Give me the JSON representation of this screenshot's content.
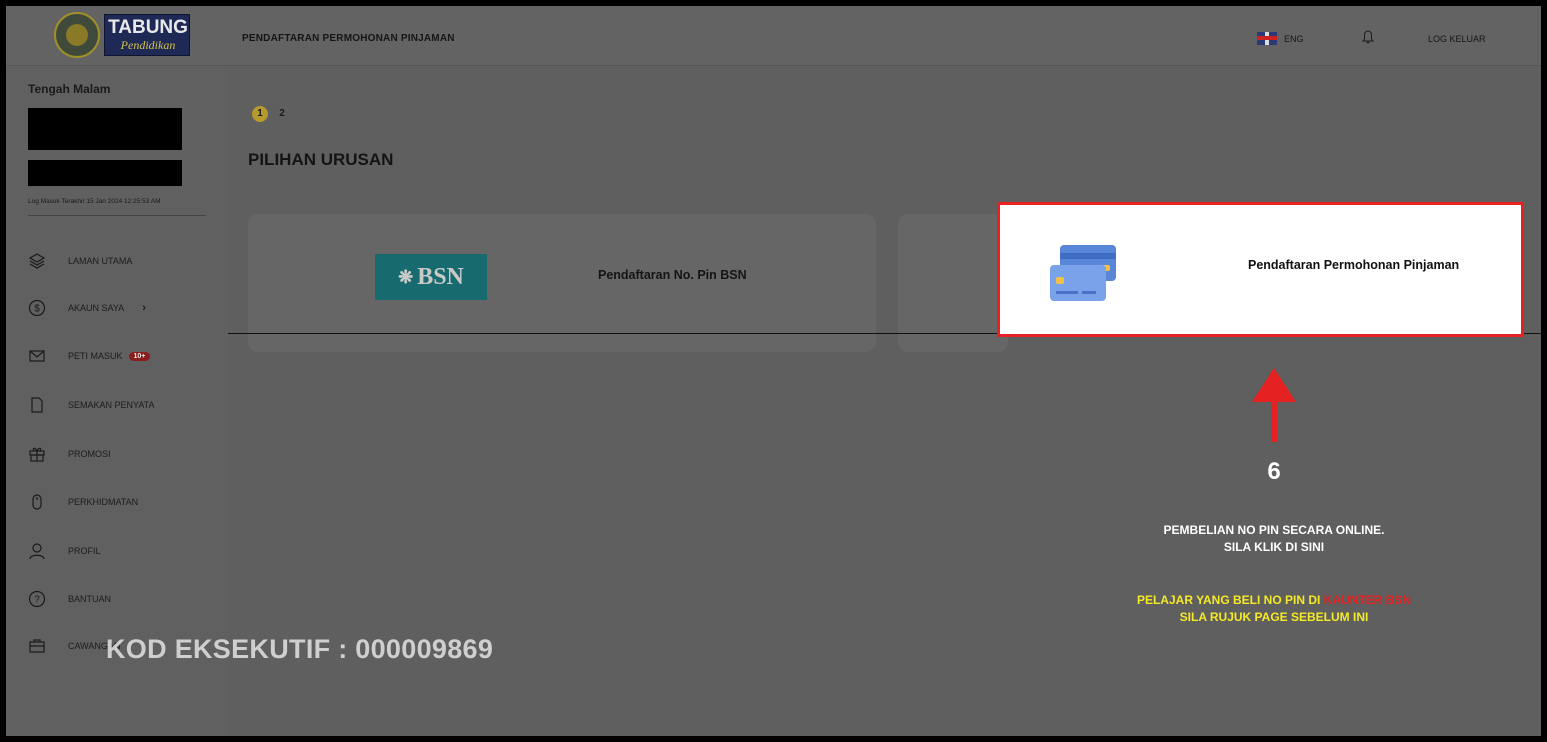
{
  "header": {
    "logo_title": "TABUNG",
    "logo_subtitle": "Pendidikan",
    "page_heading": "PENDAFTARAN PERMOHONAN PINJAMAN",
    "language": "ENG",
    "logout_label": "LOG KELUAR"
  },
  "sidebar": {
    "greeting": "Tengah Malam",
    "last_login": "Log Masuk Terakhir 15 Jan 2024 12:25:53 AM",
    "items": [
      {
        "label": "LAMAN UTAMA",
        "icon": "layers-icon"
      },
      {
        "label": "AKAUN SAYA",
        "icon": "dollar-circle-icon",
        "chevron": "›"
      },
      {
        "label": "PETI MASUK",
        "icon": "mail-icon",
        "badge": "10+"
      },
      {
        "label": "SEMAKAN PENYATA",
        "icon": "document-icon"
      },
      {
        "label": "PROMOSI",
        "icon": "gift-icon"
      },
      {
        "label": "PERKHIDMATAN",
        "icon": "mouse-icon"
      },
      {
        "label": "PROFIL",
        "icon": "user-icon"
      },
      {
        "label": "BANTUAN",
        "icon": "help-circle-icon"
      },
      {
        "label": "CAWANGAN",
        "icon": "briefcase-icon"
      }
    ]
  },
  "main": {
    "steps": [
      "1",
      "2"
    ],
    "active_step": 1,
    "section_title": "PILIHAN URUSAN",
    "cards": [
      {
        "label": "Pendaftaran No. Pin BSN",
        "logo_text": "BSN"
      },
      {
        "label": "Pendaftaran Permohonan Pinjaman",
        "icon": "credit-card-icon"
      }
    ]
  },
  "annotation": {
    "step_number": "6",
    "note_line1": "PEMBELIAN NO PIN SECARA ONLINE.",
    "note_line2": "SILA KLIK DI SINI",
    "yellow_part1": "PELAJAR YANG BELI NO PIN DI ",
    "red_part": "KAUNTER BSN",
    "yellow_line2": "SILA RUJUK PAGE SEBELUM INI",
    "executive_code": "KOD EKSEKUTIF : 000009869"
  },
  "colors": {
    "highlight_border": "#e52121",
    "note_yellow": "#f4ea25",
    "step_active": "#b79a2e",
    "bsn_teal": "#176b6f"
  }
}
